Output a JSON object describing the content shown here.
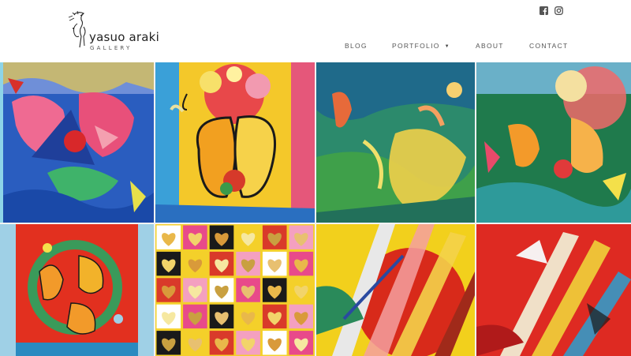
{
  "brand": {
    "name": "yasuo araki",
    "subtitle": "GALLERY"
  },
  "social": [
    {
      "icon": "facebook-icon",
      "label": "Facebook"
    },
    {
      "icon": "instagram-icon",
      "label": "Instagram"
    }
  ],
  "nav": {
    "blog": "BLOG",
    "portfolio": "PORTFOLIO",
    "about": "ABOUT",
    "contact": "CONTACT"
  },
  "gallery": {
    "artworks": [
      {
        "subject": "abstract faces in pink and blue",
        "colors": [
          "#1f4fb0",
          "#e8507a",
          "#f2d43a"
        ]
      },
      {
        "subject": "two faces with flower bouquet",
        "colors": [
          "#f6d21c",
          "#1a1a1a",
          "#e94b3c"
        ]
      },
      {
        "subject": "mermaids in green sea",
        "colors": [
          "#2e8a6a",
          "#f0cf4a",
          "#e76a3a"
        ]
      },
      {
        "subject": "figures with flowers on green",
        "colors": [
          "#1f7a3c",
          "#f39a2a",
          "#e84a6a"
        ]
      },
      {
        "subject": "three faces in wreath",
        "colors": [
          "#e2301f",
          "#f29a2a",
          "#3a9a5a"
        ]
      },
      {
        "subject": "grid of hearts",
        "colors": [
          "#f4d02a",
          "#d9a64a",
          "#e84a8a"
        ]
      },
      {
        "subject": "abstract streaks with red sun",
        "colors": [
          "#f2d01c",
          "#d82a1a",
          "#2a8a5a"
        ]
      },
      {
        "subject": "abstract streaks on red",
        "colors": [
          "#de2a22",
          "#f0d23a",
          "#2aa0d0"
        ]
      }
    ]
  }
}
